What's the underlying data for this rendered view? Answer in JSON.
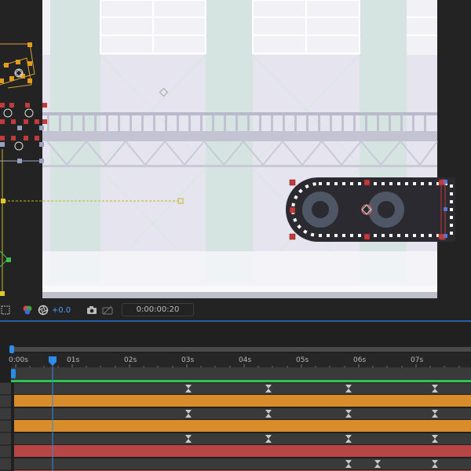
{
  "comp_toolbar": {
    "exposure": "+0.0",
    "timecode": "0:00:00:20"
  },
  "timeline": {
    "ruler_labels": [
      "0:00s",
      "01s",
      "02s",
      "03s",
      "04s",
      "05s",
      "06s",
      "07s"
    ],
    "current_time": "0:00:00:20"
  },
  "colors": {
    "accent_blue": "#2d8ceb",
    "keyframe_bar_orange": "#d88d2a",
    "keyframe_bar_red": "#b84545",
    "work_area_green": "#2ec452",
    "selection_handle_red": "#c23a3a"
  }
}
